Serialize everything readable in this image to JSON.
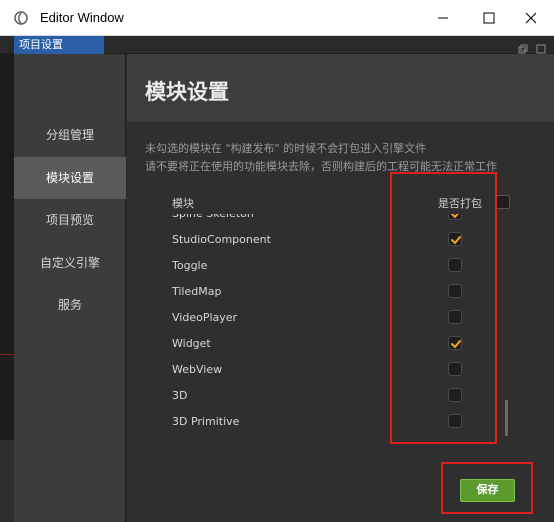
{
  "window": {
    "title": "Editor Window"
  },
  "tabs": [
    {
      "label": "项目设置"
    }
  ],
  "sidebar": {
    "items": [
      {
        "label": "分组管理"
      },
      {
        "label": "模块设置",
        "active": true
      },
      {
        "label": "项目预览"
      },
      {
        "label": "自定义引擎"
      },
      {
        "label": "服务"
      }
    ]
  },
  "main": {
    "title": "模块设置",
    "description_line1": "未勾选的模块在 \"构建发布\" 的时候不会打包进入引擎文件",
    "description_line2": "请不要将正在使用的功能模块去除，否则构建后的工程可能无法正常工作",
    "column_module": "模块",
    "column_pack": "是否打包",
    "modules": [
      {
        "name": "Spine Skeleton",
        "checked": true
      },
      {
        "name": "StudioComponent",
        "checked": true
      },
      {
        "name": "Toggle",
        "checked": false
      },
      {
        "name": "TiledMap",
        "checked": false
      },
      {
        "name": "VideoPlayer",
        "checked": false
      },
      {
        "name": "Widget",
        "checked": true
      },
      {
        "name": "WebView",
        "checked": false
      },
      {
        "name": "3D",
        "checked": false
      },
      {
        "name": "3D Primitive",
        "checked": false
      }
    ],
    "save_label": "保存"
  },
  "colors": {
    "accent_tab": "#2a5fa8",
    "check_orange": "#f5a623",
    "save_green": "#5b9a2f",
    "highlight_red": "#e0201c"
  }
}
